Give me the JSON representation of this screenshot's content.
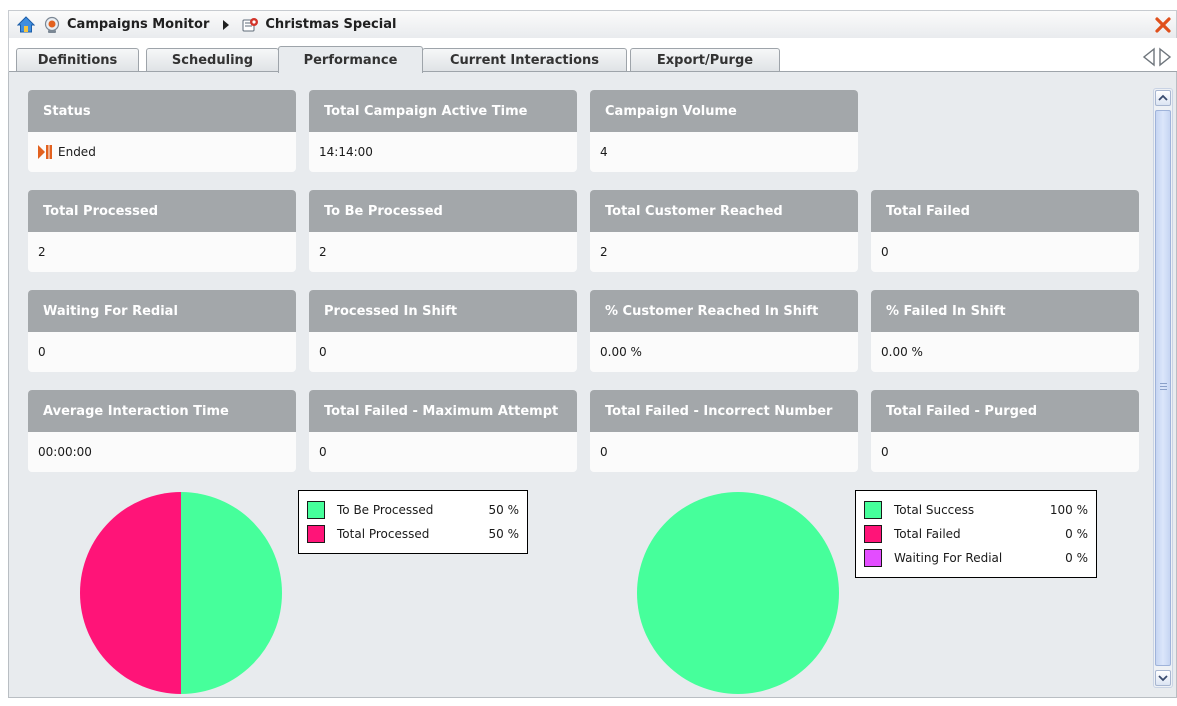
{
  "titlebar": {
    "crumb_root": "Campaigns Monitor",
    "crumb_current": "Christmas Special",
    "icons": {
      "home": "home-icon",
      "root": "campaigns-monitor-icon",
      "separator": "triangle-right-icon",
      "current": "campaign-icon",
      "close": "close-icon"
    },
    "close_color": "#e0501c"
  },
  "tabs": [
    {
      "label": "Definitions",
      "active": false
    },
    {
      "label": "Scheduling",
      "active": false
    },
    {
      "label": "Performance",
      "active": true
    },
    {
      "label": "Current Interactions",
      "active": false
    },
    {
      "label": "Export/Purge",
      "active": false
    }
  ],
  "tab_scroll": {
    "prev_icon": "triangle-left-outline-icon",
    "next_icon": "triangle-right-outline-icon"
  },
  "metrics": {
    "status": {
      "label": "Status",
      "value": "Ended",
      "icon": "ended-status-icon"
    },
    "active_time": {
      "label": "Total Campaign Active Time",
      "value": "14:14:00"
    },
    "volume": {
      "label": "Campaign Volume",
      "value": "4"
    },
    "total_processed": {
      "label": "Total Processed",
      "value": "2"
    },
    "to_be_processed": {
      "label": "To Be Processed",
      "value": "2"
    },
    "customer_reached": {
      "label": "Total Customer Reached",
      "value": "2"
    },
    "total_failed": {
      "label": "Total Failed",
      "value": "0"
    },
    "waiting_redial": {
      "label": "Waiting For Redial",
      "value": "0"
    },
    "processed_in_shift": {
      "label": "Processed In Shift",
      "value": "0"
    },
    "pct_reached_shift": {
      "label": "% Customer Reached In Shift",
      "value": "0.00 %"
    },
    "pct_failed_shift": {
      "label": "% Failed In Shift",
      "value": "0.00 %"
    },
    "avg_interaction": {
      "label": "Average Interaction Time",
      "value": "00:00:00"
    },
    "failed_max_attempts": {
      "label": "Total Failed - Maximum Attempt",
      "value": "0"
    },
    "failed_incorrect_number": {
      "label": "Total Failed - Incorrect Number",
      "value": "0"
    },
    "failed_purged": {
      "label": "Total Failed - Purged",
      "value": "0"
    }
  },
  "colors": {
    "green": "#46ff9b",
    "pink": "#ff1478",
    "magenta": "#e34dff",
    "card_header": "#a3a7aa",
    "panel_bg": "#e8ebee"
  },
  "chart_data": [
    {
      "type": "pie",
      "categories": [
        "To Be Processed",
        "Total Processed"
      ],
      "values": [
        50,
        50
      ],
      "value_labels": [
        "50 %",
        "50 %"
      ],
      "colors": [
        "#46ff9b",
        "#ff1478"
      ]
    },
    {
      "type": "pie",
      "categories": [
        "Total Success",
        "Total Failed",
        "Waiting For Redial"
      ],
      "values": [
        100,
        0,
        0
      ],
      "value_labels": [
        "100 %",
        "0 %",
        "0 %"
      ],
      "colors": [
        "#46ff9b",
        "#ff1478",
        "#e34dff"
      ]
    }
  ],
  "scrollbar": {
    "up_icon": "scroll-up-icon",
    "down_icon": "scroll-down-icon"
  }
}
